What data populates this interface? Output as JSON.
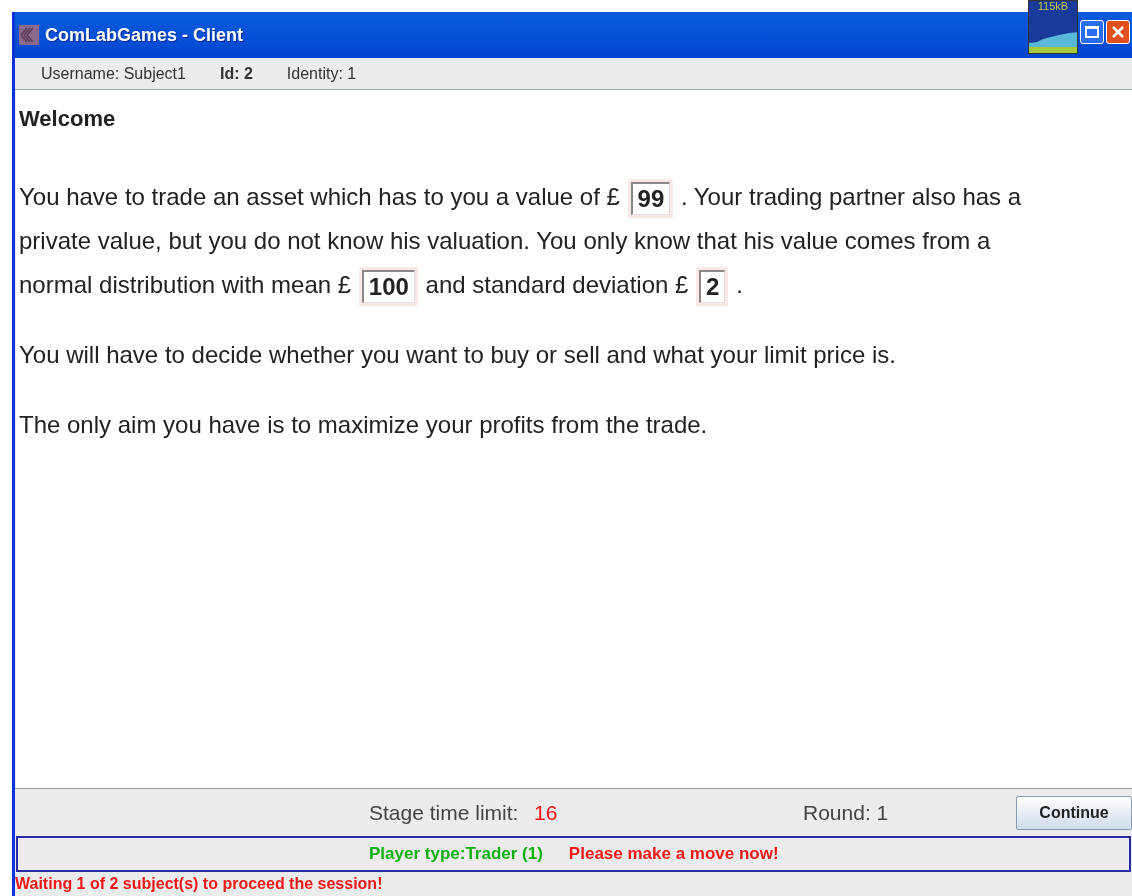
{
  "window": {
    "title": "ComLabGames - Client",
    "memory": "115kB"
  },
  "info_bar": [
    {
      "kind": "plain",
      "text": "Username: Subject1"
    },
    {
      "kind": "bold",
      "text": "Id: 2"
    },
    {
      "kind": "plain",
      "text": "Identity: 1"
    }
  ],
  "heading": "Welcome",
  "paragraphs": [
    [
      [
        {
          "kind": "text",
          "text": "You have to trade an asset which has to you a value of £"
        },
        {
          "kind": "value",
          "text": "99"
        },
        {
          "kind": "text",
          "text": ". Your trading partner also has a"
        }
      ],
      [
        {
          "kind": "text",
          "text": "private value, but you do not know his valuation. You only know that his value comes from a"
        }
      ],
      [
        {
          "kind": "text",
          "text": "normal distribution with mean £"
        },
        {
          "kind": "value",
          "text": "100"
        },
        {
          "kind": "text",
          "text": "and standard deviation £"
        },
        {
          "kind": "value",
          "text": "2"
        },
        {
          "kind": "text",
          "text": "."
        }
      ]
    ],
    [
      [
        {
          "kind": "text",
          "text": "You will have to decide whether you want to buy or sell and what your limit price is."
        }
      ]
    ],
    [
      [
        {
          "kind": "text",
          "text": "The only aim you have is to maximize your profits from the trade."
        }
      ]
    ]
  ],
  "footer": {
    "time_label": "Stage time limit:",
    "time_value": "16",
    "round": "Round: 1",
    "button": "Continue"
  },
  "status": {
    "player_type": "Player type:Trader (1)",
    "prompt": "Please make a move now!"
  },
  "waiting": "Waiting 1 of 2 subject(s) to proceed the session!"
}
